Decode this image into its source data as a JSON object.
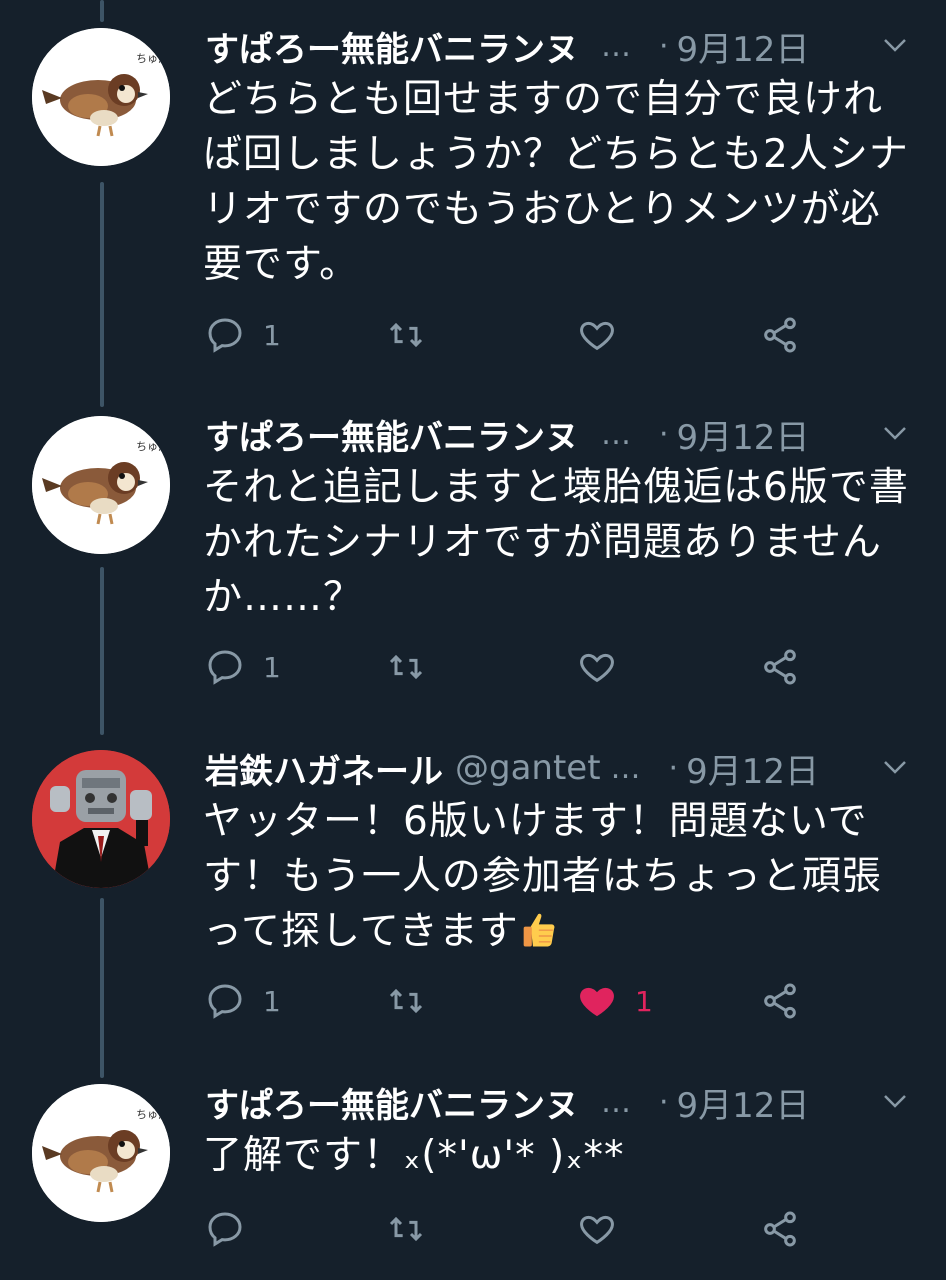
{
  "tweets": [
    {
      "name": "すぱろー無能バニランヌ",
      "handle": "",
      "ellipsis": "…",
      "dot": "·",
      "date": "9月12日",
      "text": "どちらとも回せますので自分で良ければ回しましょうか？どちらとも2人シナリオですのでもうおひとりメンツが必要です。",
      "reply_count": "1",
      "retweet_count": "",
      "like_count": "",
      "liked": false,
      "avatar": "sparrow"
    },
    {
      "name": "すぱろー無能バニランヌ",
      "handle": "",
      "ellipsis": "…",
      "dot": "·",
      "date": "9月12日",
      "text": "それと追記しますと壊胎傀逅は6版で書かれたシナリオですが問題ありませんか……？",
      "reply_count": "1",
      "retweet_count": "",
      "like_count": "",
      "liked": false,
      "avatar": "sparrow"
    },
    {
      "name": "岩鉄ハガネール",
      "handle": "@gantet",
      "ellipsis": "…",
      "dot": "·",
      "date": "9月12日",
      "text": "ヤッター！6版いけます！問題ないです！もう一人の参加者はちょっと頑張って探してきます",
      "reply_count": "1",
      "retweet_count": "",
      "like_count": "1",
      "liked": true,
      "avatar": "robot"
    },
    {
      "name": "すぱろー無能バニランヌ",
      "handle": "",
      "ellipsis": "…",
      "dot": "·",
      "date": "9月12日",
      "text": "了解です！ₓ(*'ω'* )ₓ**",
      "reply_count": "",
      "retweet_count": "",
      "like_count": "",
      "liked": false,
      "avatar": "sparrow"
    }
  ],
  "avatar_badge": "ちゅん",
  "colors": {
    "background": "#15202b",
    "secondary_text": "#8899a6",
    "like_active": "#e0245e",
    "thread_line": "#3d5466"
  },
  "icons": [
    "reply-icon",
    "retweet-icon",
    "like-icon",
    "share-icon",
    "chevron-down-icon",
    "thumbs-up-emoji"
  ]
}
